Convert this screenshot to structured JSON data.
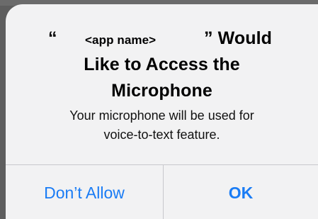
{
  "alert": {
    "title_quote_open": "“",
    "app_name": "<app name>",
    "title_line1_rest": "” Would",
    "title_line2": "Like to Access the",
    "title_line3": "Microphone",
    "message_line1": "Your microphone will be used for",
    "message_line2": "voice-to-text feature."
  },
  "buttons": {
    "deny_label": "Don’t Allow",
    "allow_label": "OK"
  },
  "colors": {
    "accent": "#1a7cf5",
    "dialog_bg": "#f2f2f3",
    "backdrop": "#5e5e5e"
  }
}
